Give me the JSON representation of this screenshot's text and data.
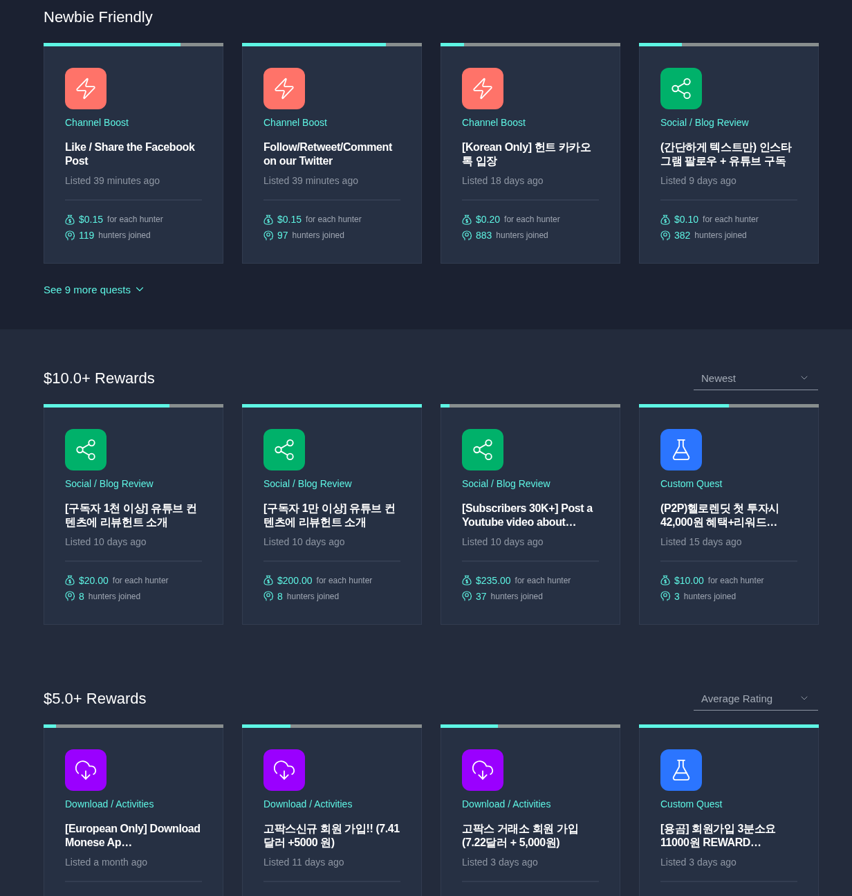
{
  "sections": [
    {
      "title": "Newbie Friendly",
      "more_link": "See 9 more quests",
      "quests": [
        {
          "kind": "boost",
          "category": "Channel Boost",
          "title": "Like / Share the Facebook Post",
          "listed": "Listed 39 minutes ago",
          "level": 0.76,
          "reward": "$0.15",
          "reward_label": "for each hunter",
          "joined": "119",
          "joined_label": "hunters joined"
        },
        {
          "kind": "boost",
          "category": "Channel Boost",
          "title": "Follow/Retweet/Comment on our Twitter",
          "listed": "Listed 39 minutes ago",
          "level": 0.8,
          "reward": "$0.15",
          "reward_label": "for each hunter",
          "joined": "97",
          "joined_label": "hunters joined"
        },
        {
          "kind": "boost",
          "category": "Channel Boost",
          "title": "[Korean Only] 헌트 카카오톡 입장",
          "listed": "Listed 18 days ago",
          "level": 0.13,
          "reward": "$0.20",
          "reward_label": "for each hunter",
          "joined": "883",
          "joined_label": "hunters joined"
        },
        {
          "kind": "social",
          "category": "Social / Blog Review",
          "title": "(간단하게 텍스트만) 인스타그램 팔로우 + 유튜브 구독",
          "listed": "Listed 9 days ago",
          "level": 0.24,
          "reward": "$0.10",
          "reward_label": "for each hunter",
          "joined": "382",
          "joined_label": "hunters joined"
        }
      ]
    },
    {
      "title": "$10.0+ Rewards",
      "sort": "Newest",
      "quests": [
        {
          "kind": "social",
          "category": "Social / Blog Review",
          "title": "[구독자 1천 이상] 유튜브 컨텐츠에 리뷰헌트 소개",
          "listed": "Listed 10 days ago",
          "level": 0.7,
          "reward": "$20.00",
          "reward_label": "for each hunter",
          "joined": "8",
          "joined_label": "hunters joined"
        },
        {
          "kind": "social",
          "category": "Social / Blog Review",
          "title": "[구독자 1만 이상] 유튜브 컨텐츠에 리뷰헌트 소개",
          "listed": "Listed 10 days ago",
          "level": 1,
          "reward": "$200.00",
          "reward_label": "for each hunter",
          "joined": "8",
          "joined_label": "hunters joined"
        },
        {
          "kind": "social",
          "category": "Social / Blog Review",
          "title": "[Subscribers 30K+] Post a Youtube video about…",
          "listed": "Listed 10 days ago",
          "level": 0.05,
          "reward": "$235.00",
          "reward_label": "for each hunter",
          "joined": "37",
          "joined_label": "hunters joined"
        },
        {
          "kind": "custom",
          "category": "Custom Quest",
          "title": "(P2P)헬로렌딧 첫 투자시 42,000원 혜택+리워드…",
          "listed": "Listed 15 days ago",
          "level": 0.5,
          "reward": "$10.00",
          "reward_label": "for each hunter",
          "joined": "3",
          "joined_label": "hunters joined"
        }
      ]
    },
    {
      "title": "$5.0+ Rewards",
      "sort": "Average Rating",
      "quests": [
        {
          "kind": "download",
          "category": "Download / Activities",
          "title": "[European Only] Download Monese Ap…",
          "listed": "Listed a month ago",
          "level": 0.07
        },
        {
          "kind": "download",
          "category": "Download / Activities",
          "title": "고팍스신규 회원 가입!! (7.41달러 +5000 원)",
          "listed": "Listed 11 days ago",
          "level": 0.27
        },
        {
          "kind": "download",
          "category": "Download / Activities",
          "title": "고팍스 거래소 회원 가입 (7.22달러 + 5,000원)",
          "listed": "Listed 3 days ago",
          "level": 0.32
        },
        {
          "kind": "custom",
          "category": "Custom Quest",
          "title": "[용곰] 회원가입 3분소요 11000원 REWARD…",
          "listed": "Listed 3 days ago",
          "level": 1
        }
      ]
    }
  ]
}
